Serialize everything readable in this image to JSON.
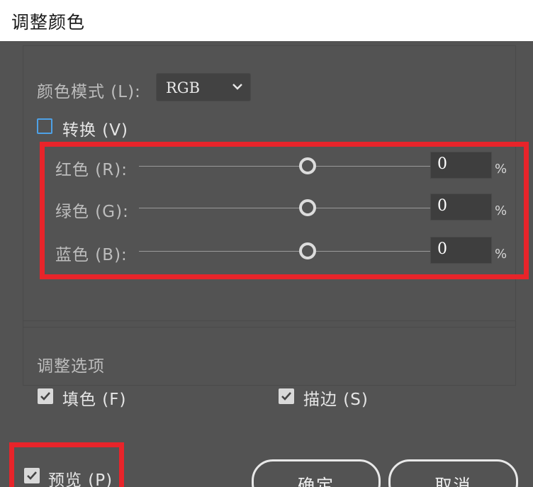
{
  "window": {
    "title": "调整颜色"
  },
  "color_mode": {
    "label": "颜色模式 (L):",
    "value": "RGB"
  },
  "convert": {
    "label": "转换 (V)",
    "checked": false
  },
  "sliders": [
    {
      "label": "红色 (R):",
      "value": "0",
      "unit": "%",
      "position": 0.5
    },
    {
      "label": "绿色 (G):",
      "value": "0",
      "unit": "%",
      "position": 0.5
    },
    {
      "label": "蓝色 (B):",
      "value": "0",
      "unit": "%",
      "position": 0.5
    }
  ],
  "adjust_options": {
    "label": "调整选项",
    "fill": {
      "label": "填色 (F)",
      "checked": true
    },
    "stroke": {
      "label": "描边 (S)",
      "checked": true
    }
  },
  "preview": {
    "label": "预览 (P)",
    "checked": true
  },
  "buttons": {
    "ok": "确定",
    "cancel": "取消"
  },
  "colors": {
    "highlight": "#e8242a",
    "checkbox_accent": "#4ea1e6",
    "dialog_bg": "#535353"
  }
}
